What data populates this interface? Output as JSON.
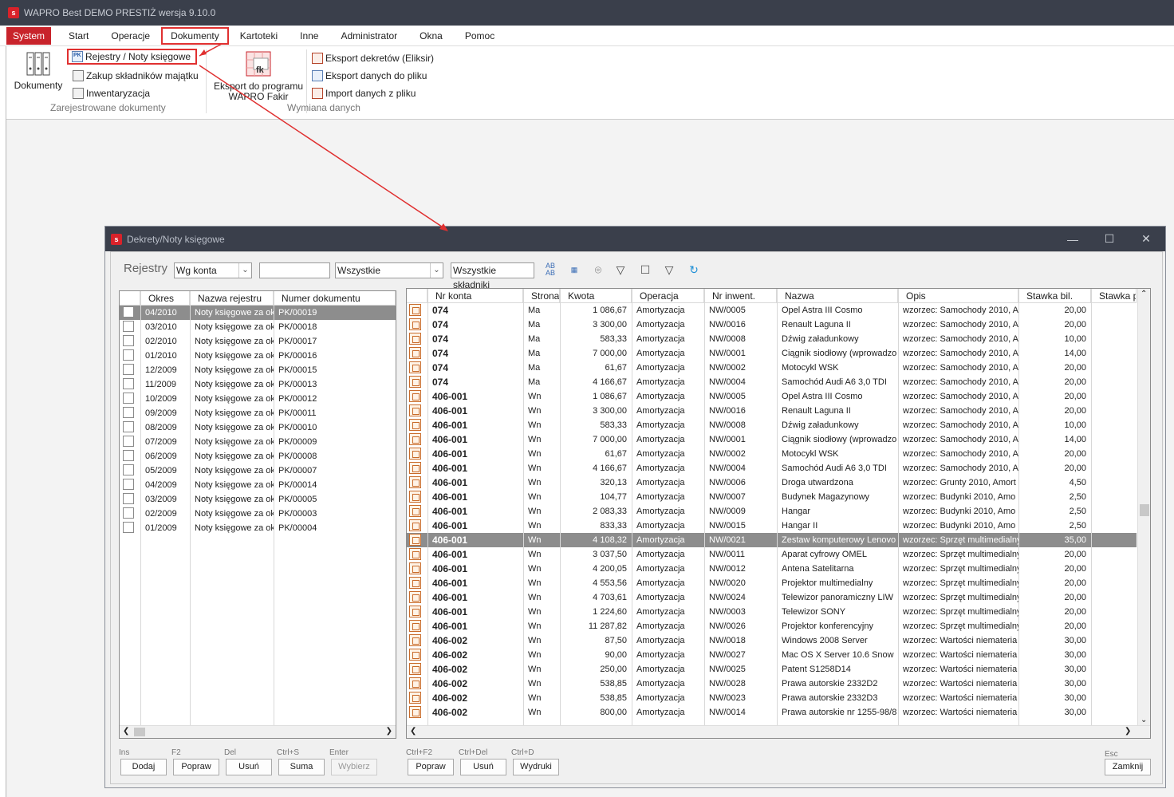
{
  "app": {
    "title": "WAPRO Best DEMO PRESTIŻ wersja 9.10.0",
    "logo_letter": "s",
    "accent_color": "#c8232b",
    "highlight_color": "#e03030"
  },
  "menu": [
    "System",
    "Start",
    "Operacje",
    "Dokumenty",
    "Kartoteki",
    "Inne",
    "Administrator",
    "Okna",
    "Pomoc"
  ],
  "ribbon": {
    "big_button": "Dokumenty",
    "small_items": [
      "Rejestry / Noty księgowe",
      "Zakup składników majątku",
      "Inwentaryzacja"
    ],
    "group1_label": "Zarejestrowane dokumenty",
    "export_button_line1": "Eksport do programu",
    "export_button_line2": "WAPRO Fakir",
    "export_icon_text": "fk",
    "exchange_items": [
      "Eksport dekretów (Eliksir)",
      "Eksport danych do pliku",
      "Import danych z pliku"
    ],
    "group2_label": "Wymiana danych"
  },
  "dialog": {
    "title": "Dekrety/Noty księgowe",
    "toolbar": {
      "label": "Rejestry",
      "mode_select": "Wg konta",
      "search_value": "",
      "filter_select": "Wszystkie",
      "components_button": "Wszystkie składniki"
    },
    "left_table": {
      "columns": [
        "Okres",
        "Nazwa rejestru",
        "Numer dokumentu"
      ],
      "rows": [
        [
          "04/2010",
          "Noty księgowe za ok",
          "PK/00019"
        ],
        [
          "03/2010",
          "Noty księgowe za ok",
          "PK/00018"
        ],
        [
          "02/2010",
          "Noty księgowe za ok",
          "PK/00017"
        ],
        [
          "01/2010",
          "Noty księgowe za ok",
          "PK/00016"
        ],
        [
          "12/2009",
          "Noty księgowe za ok",
          "PK/00015"
        ],
        [
          "11/2009",
          "Noty księgowe za ok",
          "PK/00013"
        ],
        [
          "10/2009",
          "Noty księgowe za ok",
          "PK/00012"
        ],
        [
          "09/2009",
          "Noty księgowe za ok",
          "PK/00011"
        ],
        [
          "08/2009",
          "Noty księgowe za ok",
          "PK/00010"
        ],
        [
          "07/2009",
          "Noty księgowe za ok",
          "PK/00009"
        ],
        [
          "06/2009",
          "Noty księgowe za ok",
          "PK/00008"
        ],
        [
          "05/2009",
          "Noty księgowe za ok",
          "PK/00007"
        ],
        [
          "04/2009",
          "Noty księgowe za ok",
          "PK/00014"
        ],
        [
          "03/2009",
          "Noty księgowe za ok",
          "PK/00005"
        ],
        [
          "02/2009",
          "Noty księgowe za ok",
          "PK/00003"
        ],
        [
          "01/2009",
          "Noty księgowe za ok",
          "PK/00004"
        ]
      ],
      "selected_index": 0
    },
    "right_table": {
      "columns": [
        "Nr konta",
        "Strona",
        "Kwota",
        "Operacja",
        "Nr inwent.",
        "Nazwa",
        "Opis",
        "Stawka bil.",
        "Stawka po"
      ],
      "rows": [
        [
          "074",
          "Ma",
          "1 086,67",
          "Amortyzacja",
          "NW/0005",
          "Opel Astra III Cosmo",
          "wzorzec: Samochody 2010, A",
          "20,00"
        ],
        [
          "074",
          "Ma",
          "3 300,00",
          "Amortyzacja",
          "NW/0016",
          "Renault Laguna II",
          "wzorzec: Samochody 2010, A",
          "20,00"
        ],
        [
          "074",
          "Ma",
          "583,33",
          "Amortyzacja",
          "NW/0008",
          "Dźwig załadunkowy",
          "wzorzec: Samochody 2010, A",
          "10,00"
        ],
        [
          "074",
          "Ma",
          "7 000,00",
          "Amortyzacja",
          "NW/0001",
          "Ciągnik siodłowy (wprowadzo",
          "wzorzec: Samochody 2010, A",
          "14,00"
        ],
        [
          "074",
          "Ma",
          "61,67",
          "Amortyzacja",
          "NW/0002",
          "Motocykl WSK",
          "wzorzec: Samochody 2010, A",
          "20,00"
        ],
        [
          "074",
          "Ma",
          "4 166,67",
          "Amortyzacja",
          "NW/0004",
          "Samochód Audi A6 3,0 TDI",
          "wzorzec: Samochody 2010, A",
          "20,00"
        ],
        [
          "406-001",
          "Wn",
          "1 086,67",
          "Amortyzacja",
          "NW/0005",
          "Opel Astra III Cosmo",
          "wzorzec: Samochody 2010, A",
          "20,00"
        ],
        [
          "406-001",
          "Wn",
          "3 300,00",
          "Amortyzacja",
          "NW/0016",
          "Renault Laguna II",
          "wzorzec: Samochody 2010, A",
          "20,00"
        ],
        [
          "406-001",
          "Wn",
          "583,33",
          "Amortyzacja",
          "NW/0008",
          "Dźwig załadunkowy",
          "wzorzec: Samochody 2010, A",
          "10,00"
        ],
        [
          "406-001",
          "Wn",
          "7 000,00",
          "Amortyzacja",
          "NW/0001",
          "Ciągnik siodłowy (wprowadzo",
          "wzorzec: Samochody 2010, A",
          "14,00"
        ],
        [
          "406-001",
          "Wn",
          "61,67",
          "Amortyzacja",
          "NW/0002",
          "Motocykl WSK",
          "wzorzec: Samochody 2010, A",
          "20,00"
        ],
        [
          "406-001",
          "Wn",
          "4 166,67",
          "Amortyzacja",
          "NW/0004",
          "Samochód Audi A6 3,0 TDI",
          "wzorzec: Samochody 2010, A",
          "20,00"
        ],
        [
          "406-001",
          "Wn",
          "320,13",
          "Amortyzacja",
          "NW/0006",
          "Droga utwardzona",
          "wzorzec: Grunty 2010, Amort",
          "4,50"
        ],
        [
          "406-001",
          "Wn",
          "104,77",
          "Amortyzacja",
          "NW/0007",
          "Budynek Magazynowy",
          "wzorzec: Budynki 2010, Amo",
          "2,50"
        ],
        [
          "406-001",
          "Wn",
          "2 083,33",
          "Amortyzacja",
          "NW/0009",
          "Hangar",
          "wzorzec: Budynki 2010, Amo",
          "2,50"
        ],
        [
          "406-001",
          "Wn",
          "833,33",
          "Amortyzacja",
          "NW/0015",
          "Hangar II",
          "wzorzec: Budynki 2010, Amo",
          "2,50"
        ],
        [
          "406-001",
          "Wn",
          "4 108,32",
          "Amortyzacja",
          "NW/0021",
          "Zestaw komputerowy Lenovo",
          "wzorzec: Sprzęt multimedialny",
          "35,00"
        ],
        [
          "406-001",
          "Wn",
          "3 037,50",
          "Amortyzacja",
          "NW/0011",
          "Aparat cyfrowy OMEL",
          "wzorzec: Sprzęt multimedialny",
          "20,00"
        ],
        [
          "406-001",
          "Wn",
          "4 200,05",
          "Amortyzacja",
          "NW/0012",
          "Antena Satelitarna",
          "wzorzec: Sprzęt multimedialny",
          "20,00"
        ],
        [
          "406-001",
          "Wn",
          "4 553,56",
          "Amortyzacja",
          "NW/0020",
          "Projektor multimedialny",
          "wzorzec: Sprzęt multimedialny",
          "20,00"
        ],
        [
          "406-001",
          "Wn",
          "4 703,61",
          "Amortyzacja",
          "NW/0024",
          "Telewizor panoramiczny LIW",
          "wzorzec: Sprzęt multimedialny",
          "20,00"
        ],
        [
          "406-001",
          "Wn",
          "1 224,60",
          "Amortyzacja",
          "NW/0003",
          "Telewizor SONY",
          "wzorzec: Sprzęt multimedialny",
          "20,00"
        ],
        [
          "406-001",
          "Wn",
          "11 287,82",
          "Amortyzacja",
          "NW/0026",
          "Projektor konferencyjny",
          "wzorzec: Sprzęt multimedialny",
          "20,00"
        ],
        [
          "406-002",
          "Wn",
          "87,50",
          "Amortyzacja",
          "NW/0018",
          "Windows 2008 Server",
          "wzorzec: Wartości niemateria",
          "30,00"
        ],
        [
          "406-002",
          "Wn",
          "90,00",
          "Amortyzacja",
          "NW/0027",
          "Mac OS X Server 10.6 Snow",
          "wzorzec: Wartości niemateria",
          "30,00"
        ],
        [
          "406-002",
          "Wn",
          "250,00",
          "Amortyzacja",
          "NW/0025",
          "Patent S1258D14",
          "wzorzec: Wartości niemateria",
          "30,00"
        ],
        [
          "406-002",
          "Wn",
          "538,85",
          "Amortyzacja",
          "NW/0028",
          "Prawa autorskie 2332D2",
          "wzorzec: Wartości niemateria",
          "30,00"
        ],
        [
          "406-002",
          "Wn",
          "538,85",
          "Amortyzacja",
          "NW/0023",
          "Prawa autorskie 2332D3",
          "wzorzec: Wartości niemateria",
          "30,00"
        ],
        [
          "406-002",
          "Wn",
          "800,00",
          "Amortyzacja",
          "NW/0014",
          "Prawa autorskie nr 1255-98/8",
          "wzorzec: Wartości niemateria",
          "30,00"
        ]
      ],
      "selected_index": 16
    },
    "buttons_left": [
      {
        "hint": "Ins",
        "label": "Dodaj",
        "enabled": true
      },
      {
        "hint": "F2",
        "label": "Popraw",
        "enabled": true
      },
      {
        "hint": "Del",
        "label": "Usuń",
        "enabled": true
      },
      {
        "hint": "Ctrl+S",
        "label": "Suma",
        "enabled": true
      },
      {
        "hint": "Enter",
        "label": "Wybierz",
        "enabled": false
      }
    ],
    "buttons_right": [
      {
        "hint": "Ctrl+F2",
        "label": "Popraw",
        "enabled": true
      },
      {
        "hint": "Ctrl+Del",
        "label": "Usuń",
        "enabled": true
      },
      {
        "hint": "Ctrl+D",
        "label": "Wydruki",
        "enabled": true
      }
    ],
    "close_hint": "Esc",
    "close_label": "Zamknij"
  }
}
